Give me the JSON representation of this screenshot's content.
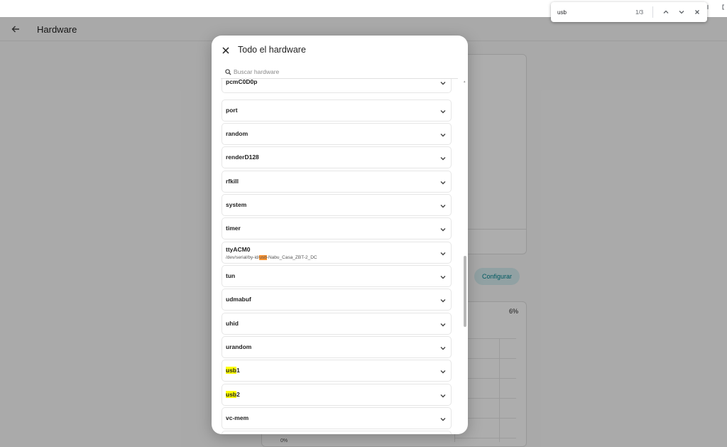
{
  "findbar": {
    "query": "usb",
    "count": "1/3"
  },
  "app": {
    "title": "Hardware",
    "configure_label": "Configurar",
    "percent_label": "6%",
    "chart_zero_label": "0%"
  },
  "dialog": {
    "title": "Todo el hardware",
    "search_placeholder": "Buscar hardware",
    "items": [
      {
        "label": "pcmC0D0p"
      },
      {
        "label": "port"
      },
      {
        "label": "random"
      },
      {
        "label": "renderD128"
      },
      {
        "label": "rfkill"
      },
      {
        "label": "system"
      },
      {
        "label": "timer"
      },
      {
        "label": "ttyACM0",
        "sub_before": "/dev/serial/by-id/",
        "sub_match": "usb",
        "sub_after": "-Nabu_Casa_ZBT-2_DC"
      },
      {
        "label": "tun"
      },
      {
        "label": "udmabuf"
      },
      {
        "label": "uhid"
      },
      {
        "label": "urandom"
      },
      {
        "match": "usb",
        "rest": "1"
      },
      {
        "match": "usb",
        "rest": "2"
      },
      {
        "label": "vc-mem"
      }
    ]
  },
  "colors": {
    "accent": "#01848f",
    "find_highlight": "#ffff00",
    "find_active_highlight": "#ff9632"
  }
}
